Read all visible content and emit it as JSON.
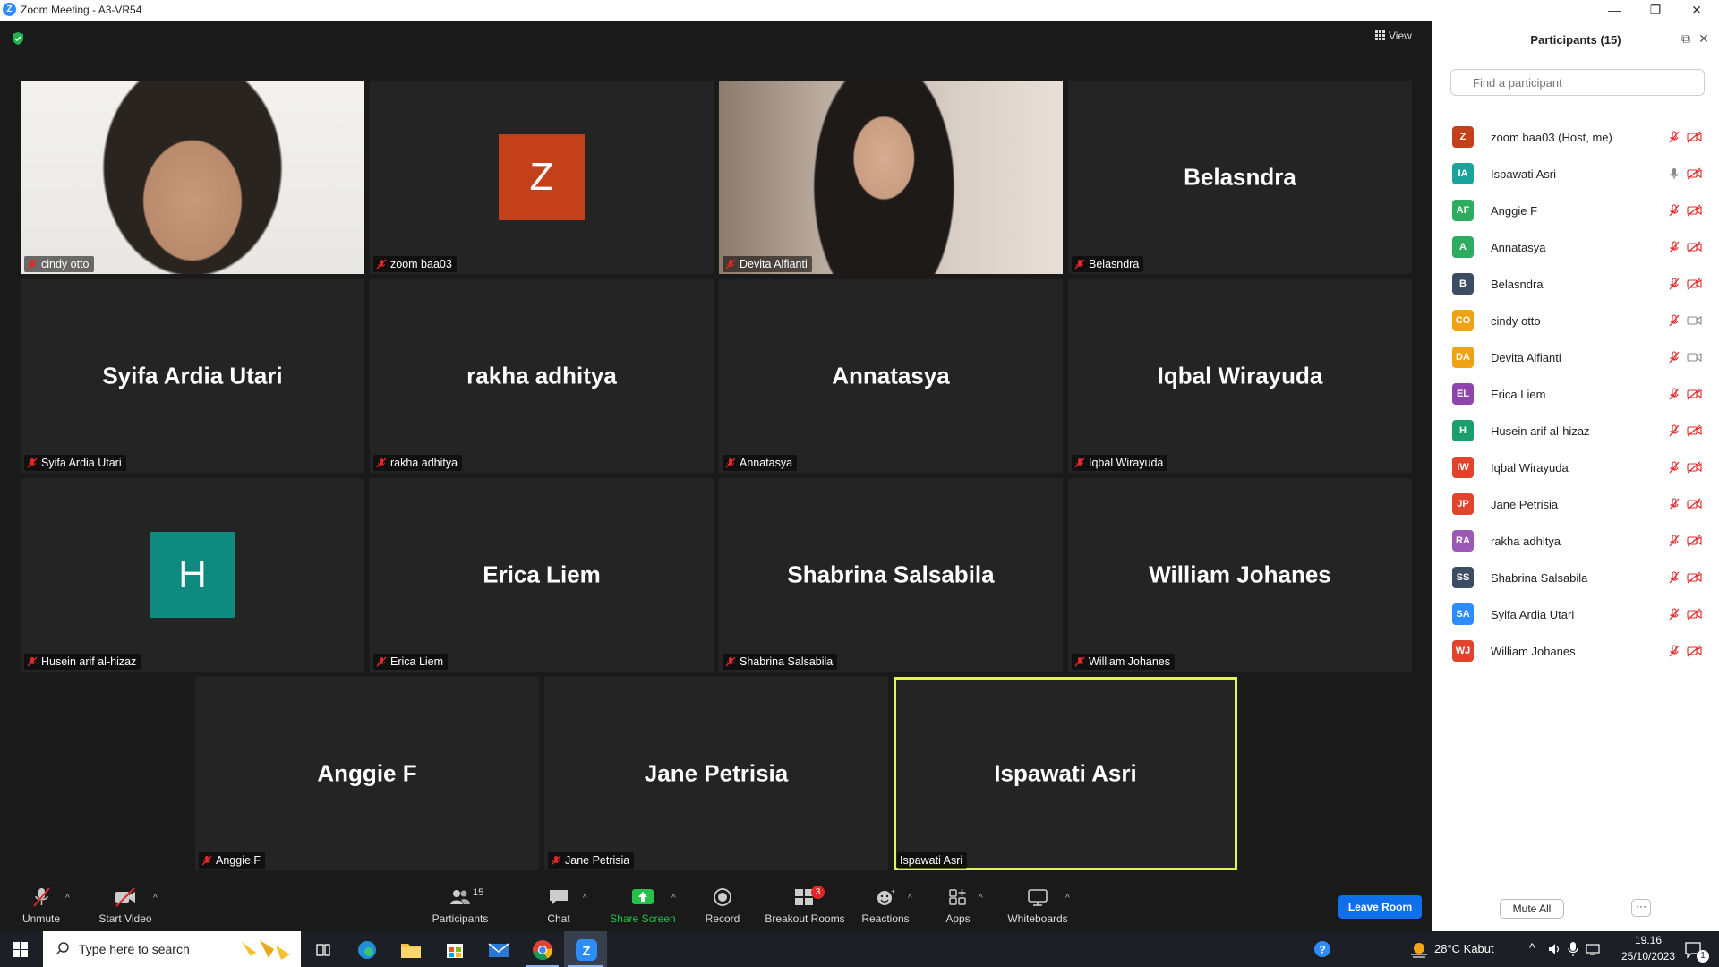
{
  "window": {
    "title": "Zoom Meeting - A3-VR54",
    "app_icon": "Z"
  },
  "view_label": "View",
  "tiles": [
    {
      "name": "cindy otto",
      "type": "video"
    },
    {
      "name": "zoom baa03",
      "type": "avatar",
      "letter": "Z",
      "color": "#c4401a"
    },
    {
      "name": "Devita Alfianti",
      "type": "video"
    },
    {
      "name": "Belasndra",
      "type": "name"
    },
    {
      "name": "Syifa Ardia Utari",
      "type": "name"
    },
    {
      "name": "rakha adhitya",
      "type": "name"
    },
    {
      "name": "Annatasya",
      "type": "name"
    },
    {
      "name": "Iqbal Wirayuda",
      "type": "name"
    },
    {
      "name": "Husein arif al-hizaz",
      "type": "avatar",
      "letter": "H",
      "color": "#0f8a7e"
    },
    {
      "name": "Erica Liem",
      "type": "name"
    },
    {
      "name": "Shabrina Salsabila",
      "type": "name"
    },
    {
      "name": "William Johanes",
      "type": "name"
    },
    {
      "name": "Anggie F",
      "type": "name"
    },
    {
      "name": "Jane Petrisia",
      "type": "name"
    },
    {
      "name": "Ispawati Asri",
      "type": "name",
      "active": true
    }
  ],
  "toolbar": {
    "unmute": "Unmute",
    "start_video": "Start Video",
    "participants": "Participants",
    "participants_count": "15",
    "chat": "Chat",
    "share_screen": "Share Screen",
    "record": "Record",
    "breakout_rooms": "Breakout Rooms",
    "breakout_badge": "3",
    "reactions": "Reactions",
    "apps": "Apps",
    "whiteboards": "Whiteboards",
    "leave": "Leave Room"
  },
  "panel": {
    "title": "Participants (15)",
    "search_placeholder": "Find a participant",
    "mute_all": "Mute All",
    "more": "···",
    "participants": [
      {
        "initials": "Z",
        "name": "zoom baa03 (Host, me)",
        "color": "#c4401a",
        "mic": "muted",
        "cam": "off"
      },
      {
        "initials": "IA",
        "name": "Ispawati Asri",
        "color": "#1aa39a",
        "mic": "on",
        "cam": "off"
      },
      {
        "initials": "AF",
        "name": "Anggie F",
        "color": "#2dab5f",
        "mic": "muted",
        "cam": "off"
      },
      {
        "initials": "A",
        "name": "Annatasya",
        "color": "#2dab5f",
        "mic": "muted",
        "cam": "off"
      },
      {
        "initials": "B",
        "name": "Belasndra",
        "color": "#3c4c63",
        "mic": "muted",
        "cam": "off"
      },
      {
        "initials": "CO",
        "name": "cindy otto",
        "color": "#f0a215",
        "mic": "muted",
        "cam": "on"
      },
      {
        "initials": "DA",
        "name": "Devita Alfianti",
        "color": "#f0a215",
        "mic": "muted",
        "cam": "on"
      },
      {
        "initials": "EL",
        "name": "Erica Liem",
        "color": "#8e44ad",
        "mic": "muted",
        "cam": "off"
      },
      {
        "initials": "H",
        "name": "Husein arif al-hizaz",
        "color": "#1a9e6b",
        "mic": "muted",
        "cam": "off"
      },
      {
        "initials": "IW",
        "name": "Iqbal Wirayuda",
        "color": "#e0432e",
        "mic": "muted",
        "cam": "off"
      },
      {
        "initials": "JP",
        "name": "Jane Petrisia",
        "color": "#e0432e",
        "mic": "muted",
        "cam": "off"
      },
      {
        "initials": "RA",
        "name": "rakha adhitya",
        "color": "#9b59b6",
        "mic": "muted",
        "cam": "off"
      },
      {
        "initials": "SS",
        "name": "Shabrina Salsabila",
        "color": "#3c4c63",
        "mic": "muted",
        "cam": "off"
      },
      {
        "initials": "SA",
        "name": "Syifa Ardia Utari",
        "color": "#2d8cff",
        "mic": "muted",
        "cam": "off"
      },
      {
        "initials": "WJ",
        "name": "William Johanes",
        "color": "#e0432e",
        "mic": "muted",
        "cam": "off"
      }
    ]
  },
  "taskbar": {
    "search_placeholder": "Type here to search",
    "weather": "28°C  Kabut",
    "time": "19.16",
    "date": "25/10/2023",
    "notifications": "1"
  }
}
